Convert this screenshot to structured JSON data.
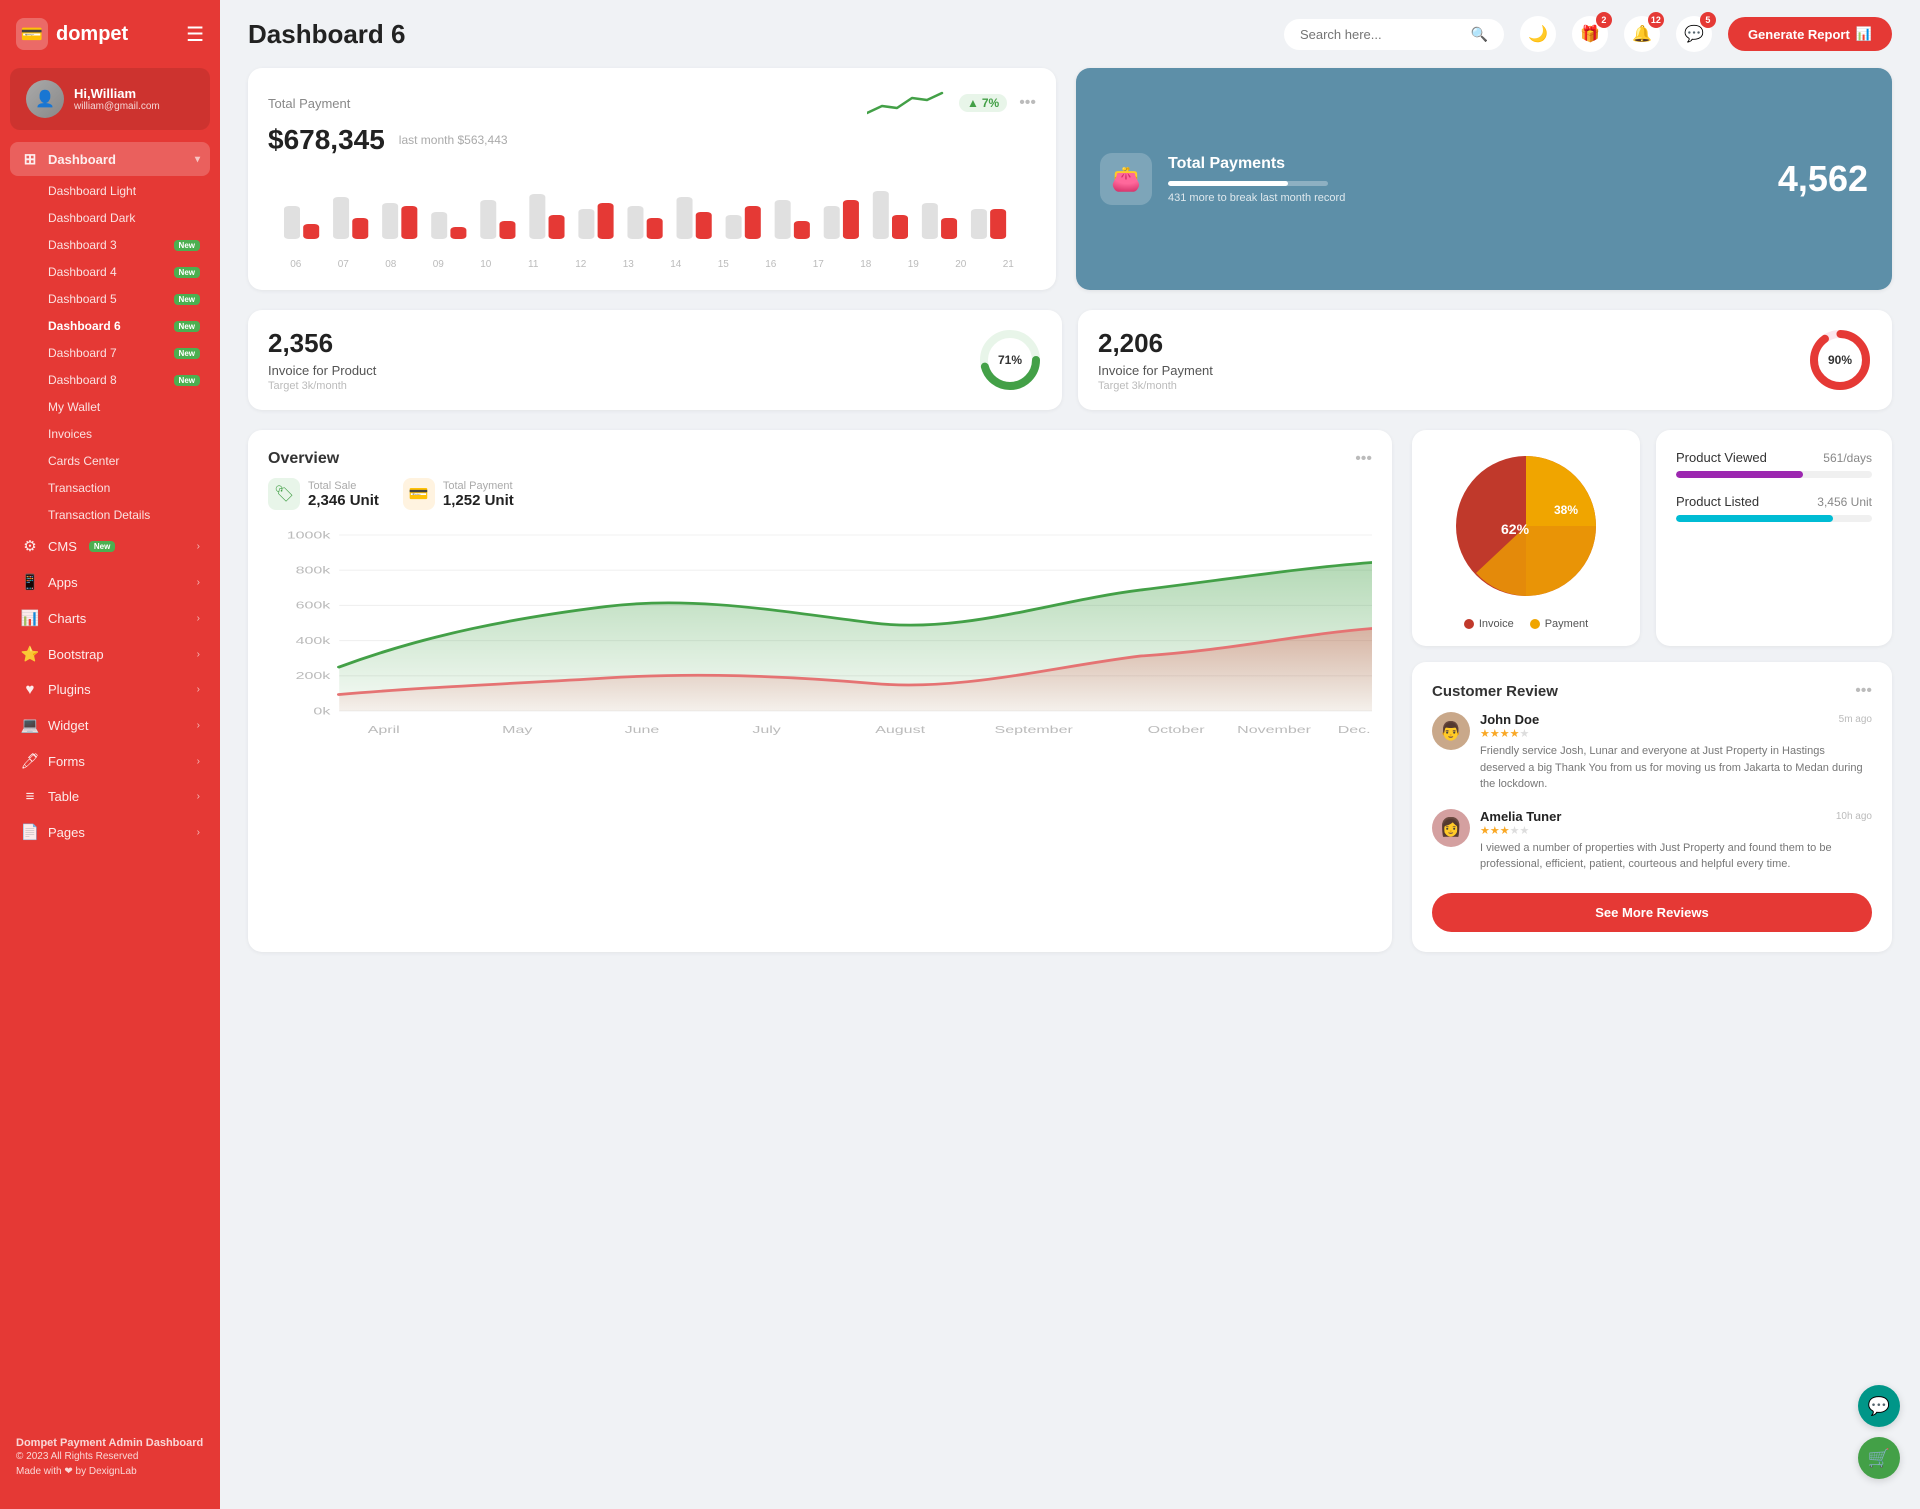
{
  "sidebar": {
    "logo": "dompet",
    "logo_icon": "💳",
    "user": {
      "name": "Hi,William",
      "email": "william@gmail.com",
      "avatar": "👤"
    },
    "dashboard_label": "Dashboard",
    "submenu": [
      {
        "id": "dashboard-light",
        "label": "Dashboard Light",
        "badge": null,
        "active": false
      },
      {
        "id": "dashboard-dark",
        "label": "Dashboard Dark",
        "badge": null,
        "active": false
      },
      {
        "id": "dashboard-3",
        "label": "Dashboard 3",
        "badge": "New",
        "active": false
      },
      {
        "id": "dashboard-4",
        "label": "Dashboard 4",
        "badge": "New",
        "active": false
      },
      {
        "id": "dashboard-5",
        "label": "Dashboard 5",
        "badge": "New",
        "active": false
      },
      {
        "id": "dashboard-6",
        "label": "Dashboard 6",
        "badge": "New",
        "active": true
      },
      {
        "id": "dashboard-7",
        "label": "Dashboard 7",
        "badge": "New",
        "active": false
      },
      {
        "id": "dashboard-8",
        "label": "Dashboard 8",
        "badge": "New",
        "active": false
      },
      {
        "id": "my-wallet",
        "label": "My Wallet",
        "badge": null,
        "active": false
      },
      {
        "id": "invoices",
        "label": "Invoices",
        "badge": null,
        "active": false
      },
      {
        "id": "cards-center",
        "label": "Cards Center",
        "badge": null,
        "active": false
      },
      {
        "id": "transaction",
        "label": "Transaction",
        "badge": null,
        "active": false
      },
      {
        "id": "transaction-details",
        "label": "Transaction Details",
        "badge": null,
        "active": false
      }
    ],
    "nav_items": [
      {
        "id": "cms",
        "label": "CMS",
        "icon": "⚙️",
        "badge": "New",
        "has_arrow": true
      },
      {
        "id": "apps",
        "label": "Apps",
        "icon": "📱",
        "badge": null,
        "has_arrow": true
      },
      {
        "id": "charts",
        "label": "Charts",
        "icon": "📊",
        "badge": null,
        "has_arrow": true
      },
      {
        "id": "bootstrap",
        "label": "Bootstrap",
        "icon": "⭐",
        "badge": null,
        "has_arrow": true
      },
      {
        "id": "plugins",
        "label": "Plugins",
        "icon": "❤️",
        "badge": null,
        "has_arrow": true
      },
      {
        "id": "widget",
        "label": "Widget",
        "icon": "💻",
        "badge": null,
        "has_arrow": true
      },
      {
        "id": "forms",
        "label": "Forms",
        "icon": "🖊️",
        "badge": null,
        "has_arrow": true
      },
      {
        "id": "table",
        "label": "Table",
        "icon": "≡",
        "badge": null,
        "has_arrow": true
      },
      {
        "id": "pages",
        "label": "Pages",
        "icon": "📄",
        "badge": null,
        "has_arrow": true
      }
    ],
    "footer": {
      "title": "Dompet Payment Admin Dashboard",
      "copyright": "© 2023 All Rights Reserved",
      "made_with": "Made with ❤ by DexignLab"
    }
  },
  "header": {
    "title": "Dashboard 6",
    "search_placeholder": "Search here...",
    "icons": {
      "moon": "🌙",
      "gift_badge": "2",
      "bell_badge": "12",
      "chat_badge": "5"
    },
    "generate_btn": "Generate Report"
  },
  "total_payment": {
    "title": "Total Payment",
    "amount": "$678,345",
    "last_month_label": "last month $563,443",
    "trend_pct": "7%",
    "bars": [
      {
        "gray": 55,
        "red": 25
      },
      {
        "gray": 70,
        "red": 35
      },
      {
        "gray": 60,
        "red": 55
      },
      {
        "gray": 45,
        "red": 20
      },
      {
        "gray": 65,
        "red": 30
      },
      {
        "gray": 75,
        "red": 40
      },
      {
        "gray": 50,
        "red": 60
      },
      {
        "gray": 55,
        "red": 35
      },
      {
        "gray": 70,
        "red": 45
      },
      {
        "gray": 40,
        "red": 55
      },
      {
        "gray": 65,
        "red": 30
      },
      {
        "gray": 55,
        "red": 65
      },
      {
        "gray": 80,
        "red": 40
      },
      {
        "gray": 60,
        "red": 35
      },
      {
        "gray": 50,
        "red": 50
      }
    ],
    "chart_labels": [
      "06",
      "07",
      "08",
      "09",
      "10",
      "11",
      "12",
      "13",
      "14",
      "15",
      "16",
      "17",
      "18",
      "19",
      "20",
      "21"
    ]
  },
  "total_payments_blue": {
    "title": "Total Payments",
    "subtitle": "431 more to break last month record",
    "number": "4,562",
    "progress_pct": 75
  },
  "invoice_product": {
    "number": "2,356",
    "label": "Invoice for Product",
    "sub": "Target 3k/month",
    "pct": 71,
    "color": "#43a047"
  },
  "invoice_payment": {
    "number": "2,206",
    "label": "Invoice for Payment",
    "sub": "Target 3k/month",
    "pct": 90,
    "color": "#e53935"
  },
  "overview": {
    "title": "Overview",
    "total_sale": {
      "label": "Total Sale",
      "value": "2,346 Unit"
    },
    "total_payment": {
      "label": "Total Payment",
      "value": "1,252 Unit"
    },
    "y_labels": [
      "1000k",
      "800k",
      "600k",
      "400k",
      "200k",
      "0k"
    ],
    "x_labels": [
      "April",
      "May",
      "June",
      "July",
      "August",
      "September",
      "October",
      "November",
      "Dec."
    ]
  },
  "pie_chart": {
    "invoice_pct": 62,
    "payment_pct": 38,
    "invoice_label": "Invoice",
    "payment_label": "Payment",
    "invoice_color": "#c0392b",
    "payment_color": "#f0a500"
  },
  "product_stats": {
    "viewed": {
      "label": "Product Viewed",
      "value": "561/days",
      "pct": 65,
      "color": "#9c27b0"
    },
    "listed": {
      "label": "Product Listed",
      "value": "3,456 Unit",
      "pct": 80,
      "color": "#00bcd4"
    }
  },
  "customer_review": {
    "title": "Customer Review",
    "reviews": [
      {
        "name": "John Doe",
        "time": "5m ago",
        "stars": 4,
        "text": "Friendly service Josh, Lunar and everyone at Just Property in Hastings deserved a big Thank You from us for moving us from Jakarta to Medan during the lockdown.",
        "avatar": "👨"
      },
      {
        "name": "Amelia Tuner",
        "time": "10h ago",
        "stars": 3,
        "text": "I viewed a number of properties with Just Property and found them to be professional, efficient, patient, courteous and helpful every time.",
        "avatar": "👩"
      }
    ],
    "see_more_btn": "See More Reviews"
  },
  "float_btns": {
    "support": "💬",
    "cart": "🛒"
  }
}
